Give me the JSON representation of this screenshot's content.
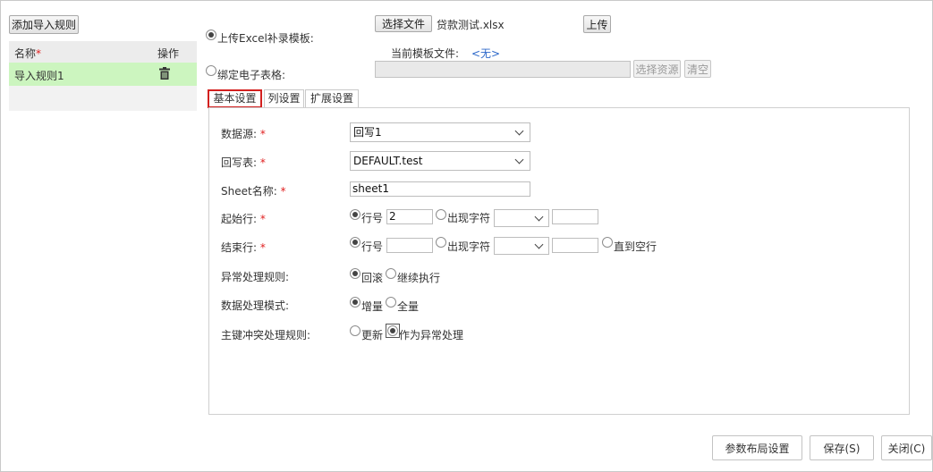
{
  "left": {
    "add_rule_button": "添加导入规则",
    "table_header_name": "名称",
    "table_header_action": "操作",
    "required_mark": "*",
    "rules": [
      {
        "name": "导入规则1"
      }
    ]
  },
  "source": {
    "upload_option_label": "上传Excel补录模板:",
    "choose_file_button": "选择文件",
    "file_name": "贷款测试.xlsx",
    "upload_button": "上传",
    "current_template_label": "当前模板文件:",
    "current_template_value": "<无>",
    "bind_option_label": "绑定电子表格:",
    "choose_resource_button": "选择资源",
    "clear_button": "清空"
  },
  "tabs": [
    {
      "label": "基本设置",
      "active": true
    },
    {
      "label": "列设置",
      "active": false
    },
    {
      "label": "扩展设置",
      "active": false
    }
  ],
  "form": {
    "datasource_label": "数据源:",
    "datasource_value": "回写1",
    "writeback_table_label": "回写表:",
    "writeback_table_value": "DEFAULT.test",
    "sheet_name_label": "Sheet名称:",
    "sheet_name_value": "sheet1",
    "start_row_label": "起始行:",
    "start_row_option_line": "行号",
    "start_row_line_value": "2",
    "start_row_option_char": "出现字符",
    "end_row_label": "结束行:",
    "end_row_option_line": "行号",
    "end_row_line_value": "",
    "end_row_option_char": "出现字符",
    "end_row_option_blank": "直到空行",
    "error_rule_label": "异常处理规则:",
    "error_rule_rollback": "回滚",
    "error_rule_continue": "继续执行",
    "process_mode_label": "数据处理模式:",
    "process_mode_increment": "增量",
    "process_mode_full": "全量",
    "pk_conflict_label": "主键冲突处理规则:",
    "pk_conflict_update": "更新",
    "pk_conflict_error": "作为异常处理"
  },
  "footer": {
    "param_layout_button": "参数布局设置",
    "save_button": "保存(S)",
    "close_button": "关闭(C)"
  }
}
